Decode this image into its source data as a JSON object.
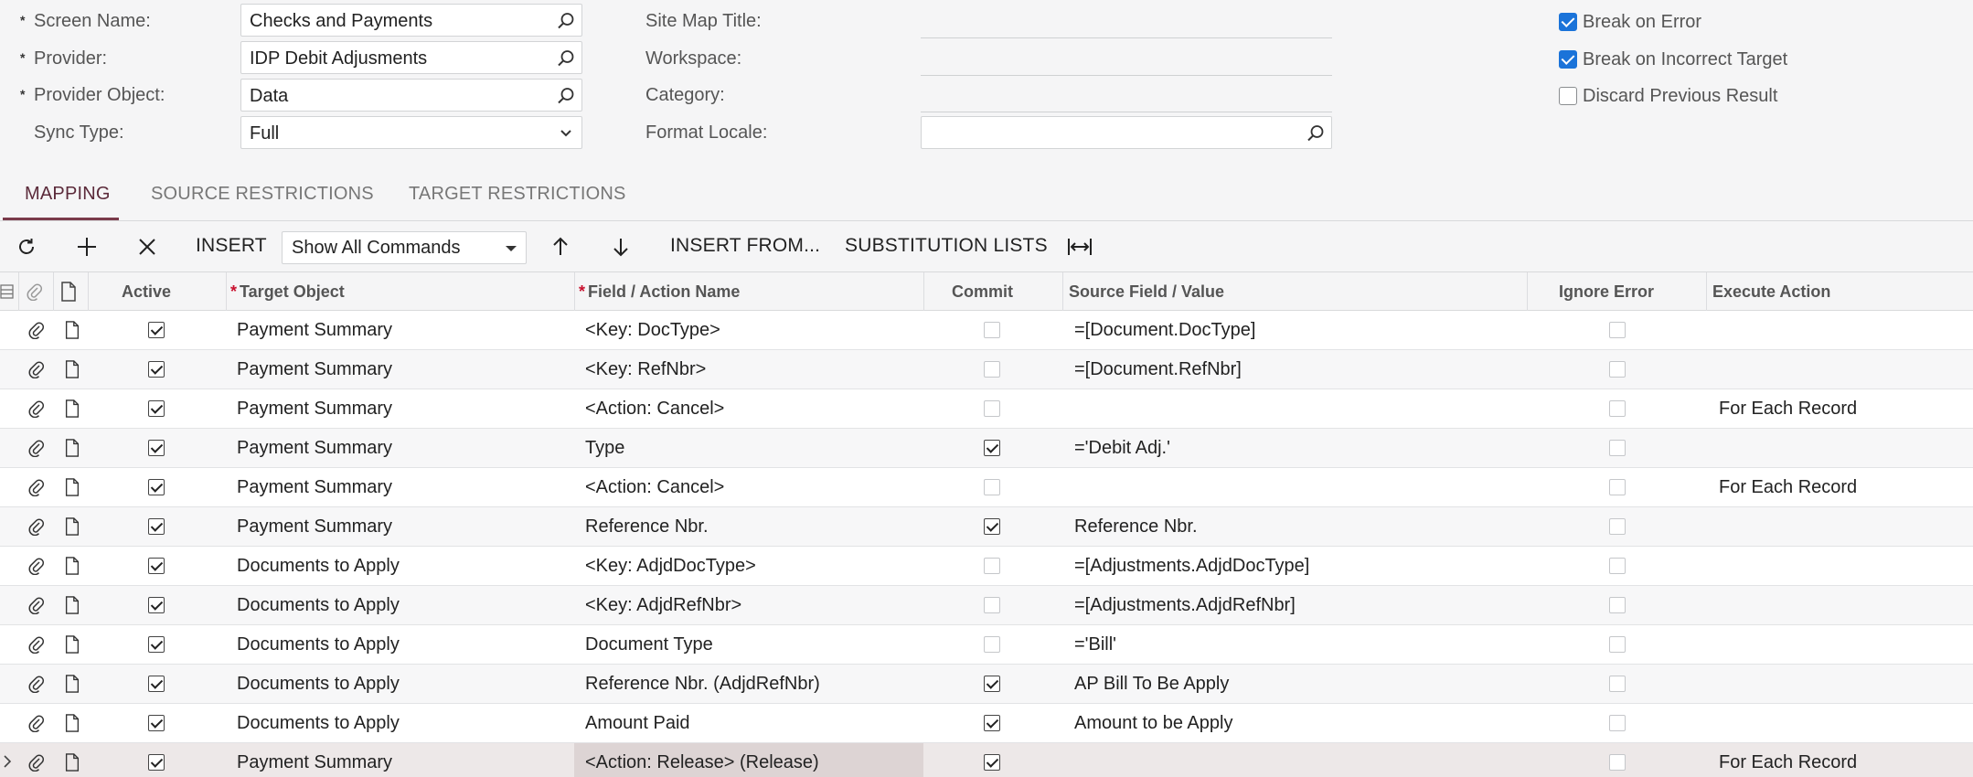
{
  "form": {
    "screen_name": {
      "label": "Screen Name:",
      "value": "Checks and Payments"
    },
    "provider": {
      "label": "Provider:",
      "value": "IDP Debit Adjusments"
    },
    "provider_object": {
      "label": "Provider Object:",
      "value": "Data"
    },
    "sync_type": {
      "label": "Sync Type:",
      "value": "Full"
    },
    "site_map_title": {
      "label": "Site Map Title:",
      "value": ""
    },
    "workspace": {
      "label": "Workspace:",
      "value": ""
    },
    "category": {
      "label": "Category:",
      "value": ""
    },
    "format_locale": {
      "label": "Format Locale:",
      "value": ""
    },
    "break_on_error": {
      "label": "Break on Error",
      "checked": true
    },
    "break_on_incorrect_target": {
      "label": "Break on Incorrect Target",
      "checked": true
    },
    "discard_previous_result": {
      "label": "Discard Previous Result",
      "checked": false
    }
  },
  "tabs": [
    {
      "label": "MAPPING",
      "active": true
    },
    {
      "label": "SOURCE RESTRICTIONS",
      "active": false
    },
    {
      "label": "TARGET RESTRICTIONS",
      "active": false
    }
  ],
  "toolbar": {
    "insert_label": "INSERT",
    "command_filter": "Show All Commands",
    "insert_from_label": "INSERT FROM...",
    "substitution_lists_label": "SUBSTITUTION LISTS"
  },
  "grid": {
    "columns": {
      "active": "Active",
      "target_object": "Target Object",
      "field_action": "Field / Action Name",
      "commit": "Commit",
      "source_field": "Source Field / Value",
      "ignore_error": "Ignore Error",
      "execute_action": "Execute Action"
    },
    "rows": [
      {
        "active": true,
        "target_object": "Payment Summary",
        "field_action": "<Key: DocType>",
        "commit": false,
        "source_field": "=[Document.DocType]",
        "ignore_error": false,
        "execute_action": ""
      },
      {
        "active": true,
        "target_object": "Payment Summary",
        "field_action": "<Key: RefNbr>",
        "commit": false,
        "source_field": "=[Document.RefNbr]",
        "ignore_error": false,
        "execute_action": ""
      },
      {
        "active": true,
        "target_object": "Payment Summary",
        "field_action": "<Action: Cancel>",
        "commit": false,
        "source_field": "",
        "ignore_error": false,
        "execute_action": "For Each Record"
      },
      {
        "active": true,
        "target_object": "Payment Summary",
        "field_action": "Type",
        "commit": true,
        "source_field": "='Debit Adj.'",
        "ignore_error": false,
        "execute_action": ""
      },
      {
        "active": true,
        "target_object": "Payment Summary",
        "field_action": "<Action: Cancel>",
        "commit": false,
        "source_field": "",
        "ignore_error": false,
        "execute_action": "For Each Record"
      },
      {
        "active": true,
        "target_object": "Payment Summary",
        "field_action": "Reference Nbr.",
        "commit": true,
        "source_field": "Reference Nbr.",
        "ignore_error": false,
        "execute_action": ""
      },
      {
        "active": true,
        "target_object": "Documents to Apply",
        "field_action": "<Key: AdjdDocType>",
        "commit": false,
        "source_field": "=[Adjustments.AdjdDocType]",
        "ignore_error": false,
        "execute_action": ""
      },
      {
        "active": true,
        "target_object": "Documents to Apply",
        "field_action": "<Key: AdjdRefNbr>",
        "commit": false,
        "source_field": "=[Adjustments.AdjdRefNbr]",
        "ignore_error": false,
        "execute_action": ""
      },
      {
        "active": true,
        "target_object": "Documents to Apply",
        "field_action": "Document Type",
        "commit": false,
        "source_field": "='Bill'",
        "ignore_error": false,
        "execute_action": ""
      },
      {
        "active": true,
        "target_object": "Documents to Apply",
        "field_action": "Reference Nbr. (AdjdRefNbr)",
        "commit": true,
        "source_field": "AP Bill To Be Apply",
        "ignore_error": false,
        "execute_action": ""
      },
      {
        "active": true,
        "target_object": "Documents to Apply",
        "field_action": "Amount Paid",
        "commit": true,
        "source_field": "Amount to be Apply",
        "ignore_error": false,
        "execute_action": ""
      },
      {
        "active": true,
        "target_object": "Payment Summary",
        "field_action": "<Action: Release> (Release)",
        "commit": true,
        "source_field": "",
        "ignore_error": false,
        "execute_action": "For Each Record",
        "selected": true
      }
    ]
  }
}
